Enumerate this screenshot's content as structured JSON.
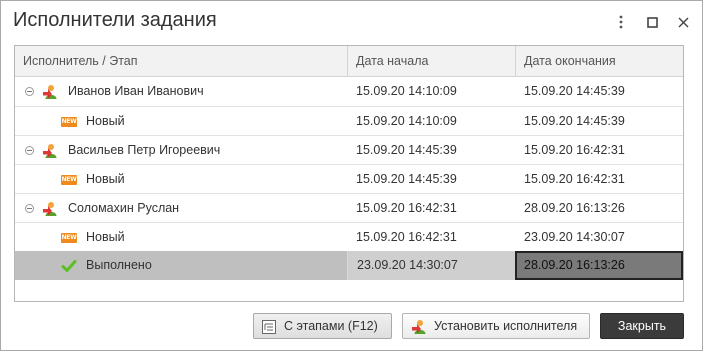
{
  "window": {
    "title": "Исполнители задания"
  },
  "grid": {
    "columns": [
      "Исполнитель / Этап",
      "Дата начала",
      "Дата окончания"
    ],
    "rows": [
      {
        "kind": "performer",
        "name": "Иванов Иван Иванович",
        "start": "15.09.20 14:10:09",
        "end": "15.09.20 14:45:39"
      },
      {
        "kind": "stage",
        "name": "Новый",
        "icon": "new-badge-icon",
        "badge": "NEW",
        "start": "15.09.20 14:10:09",
        "end": "15.09.20 14:45:39"
      },
      {
        "kind": "performer",
        "name": "Васильев Петр Игореевич",
        "start": "15.09.20 14:45:39",
        "end": "15.09.20 16:42:31"
      },
      {
        "kind": "stage",
        "name": "Новый",
        "icon": "new-badge-icon",
        "badge": "NEW",
        "start": "15.09.20 14:45:39",
        "end": "15.09.20 16:42:31"
      },
      {
        "kind": "performer",
        "name": "Соломахин Руслан",
        "start": "15.09.20 16:42:31",
        "end": "28.09.20 16:13:26"
      },
      {
        "kind": "stage",
        "name": "Новый",
        "icon": "new-badge-icon",
        "badge": "NEW",
        "start": "15.09.20 16:42:31",
        "end": "23.09.20 14:30:07"
      },
      {
        "kind": "stage",
        "name": "Выполнено",
        "icon": "check-icon",
        "start": "23.09.20 14:30:07",
        "end": "28.09.20 16:13:26",
        "selected": true
      }
    ]
  },
  "buttons": {
    "stages": "С этапами (F12)",
    "assign": "Установить исполнителя",
    "close": "Закрыть"
  },
  "colors": {
    "selected_row": "#bfbfbf",
    "close_button": "#3b3b3b",
    "new_badge": "#f08a1c",
    "check": "#5bbf21"
  }
}
